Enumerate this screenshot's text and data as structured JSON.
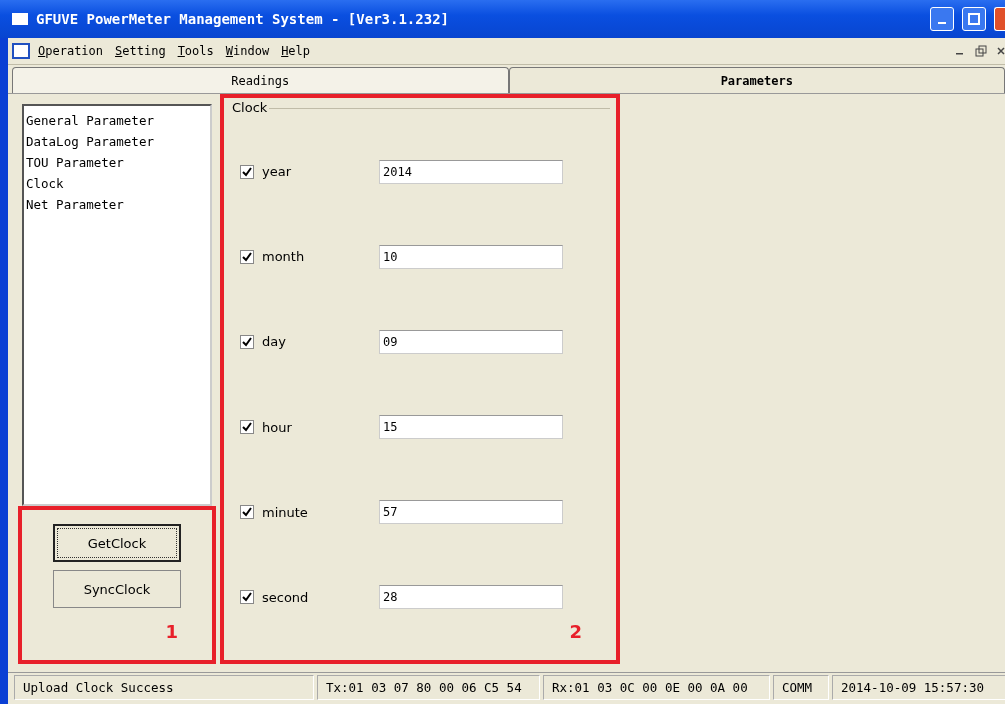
{
  "window": {
    "title": "GFUVE PowerMeter Management System - [Ver3.1.232]"
  },
  "menu": [
    {
      "label": "Operation"
    },
    {
      "label": "Setting"
    },
    {
      "label": "Tools"
    },
    {
      "label": "Window"
    },
    {
      "label": "Help"
    }
  ],
  "tabs": [
    {
      "label": "Readings",
      "selected": false
    },
    {
      "label": "Parameters",
      "selected": true
    }
  ],
  "sidebar": {
    "items": [
      {
        "label": "General Parameter",
        "selected": false
      },
      {
        "label": "DataLog Parameter",
        "selected": false
      },
      {
        "label": "TOU Parameter",
        "selected": false
      },
      {
        "label": "Clock",
        "selected": false
      },
      {
        "label": "Net Parameter",
        "selected": false
      }
    ],
    "buttons": [
      {
        "label": "GetClock",
        "focused": true
      },
      {
        "label": "SyncClock",
        "focused": false
      }
    ],
    "annotation": "1"
  },
  "clock": {
    "title": "Clock",
    "annotation": "2",
    "fields": [
      {
        "label": "year",
        "checked": true,
        "value": "2014"
      },
      {
        "label": "month",
        "checked": true,
        "value": "10"
      },
      {
        "label": "day",
        "checked": true,
        "value": "09"
      },
      {
        "label": "hour",
        "checked": true,
        "value": "15"
      },
      {
        "label": "minute",
        "checked": true,
        "value": "57"
      },
      {
        "label": "second",
        "checked": true,
        "value": "28"
      }
    ]
  },
  "status_bar": [
    "Upload Clock Success",
    "Tx:01 03 07 80 00 06 C5 54",
    "Rx:01 03 0C 00 0E 00 0A 00",
    "COMM",
    "2014-10-09 15:57:30"
  ]
}
